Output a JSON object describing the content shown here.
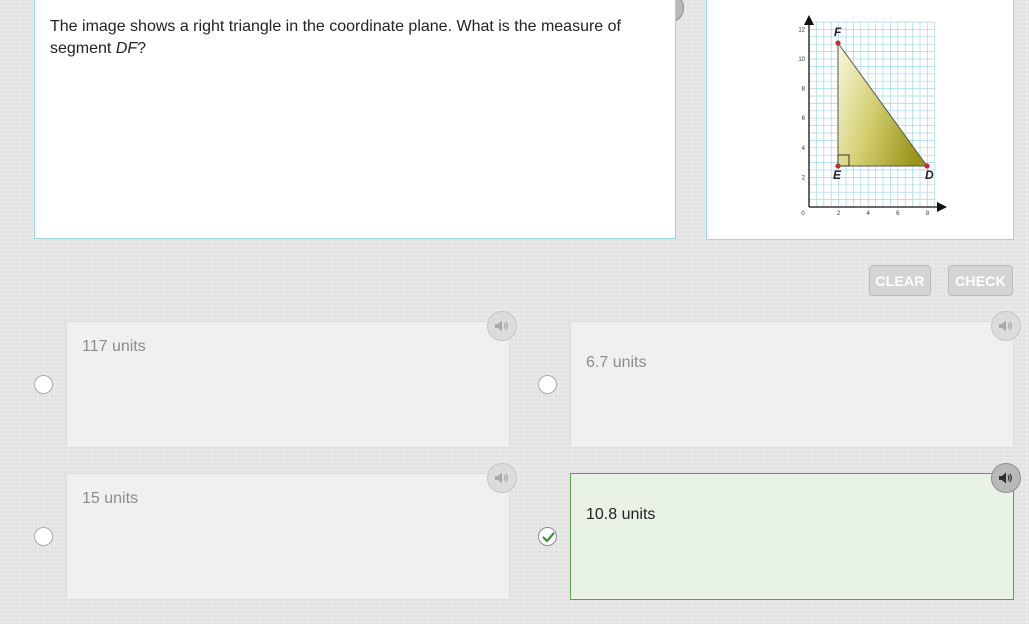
{
  "question": {
    "text_before": "The image shows a right triangle in the coordinate plane. What is the measure of segment ",
    "segment": "DF",
    "text_after": "?"
  },
  "figure": {
    "x_axis_ticks": [
      "0",
      "2",
      "4",
      "6",
      "8"
    ],
    "y_axis_ticks": [
      "2",
      "4",
      "6",
      "8",
      "10",
      "12"
    ],
    "point_labels": {
      "F": "F",
      "E": "E",
      "D": "D"
    },
    "colors": {
      "grid": "#9fd8f0",
      "triangle_fill_light": "#f2f0c8",
      "triangle_fill_dark": "#a8a020",
      "point": "#c0302a"
    }
  },
  "actions": {
    "clear_label": "CLEAR",
    "check_label": "CHECK"
  },
  "options": [
    {
      "label": "117 units",
      "selected": false
    },
    {
      "label": "6.7 units",
      "selected": false
    },
    {
      "label": "15 units",
      "selected": false
    },
    {
      "label": "10.8 units",
      "selected": true
    }
  ],
  "icons": {
    "audio": "speaker-icon",
    "selected": "checkmark-icon"
  },
  "colors": {
    "accent_green": "#57a04f",
    "panel_border": "#9fd3e6",
    "selected_bg": "#e8f3e6"
  }
}
